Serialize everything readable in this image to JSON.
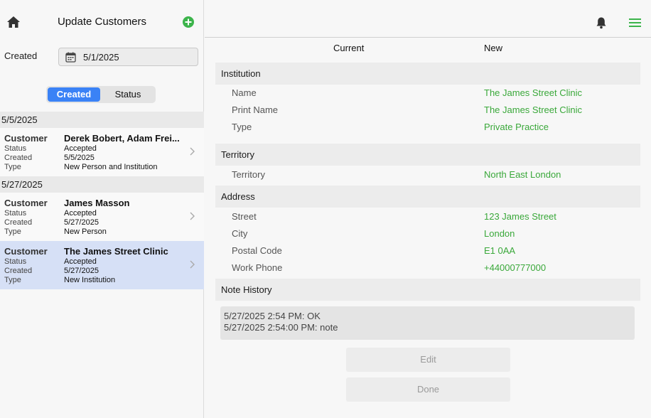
{
  "header": {
    "title": "Update Customers"
  },
  "filter": {
    "created_label": "Created",
    "created_date": "5/1/2025"
  },
  "segmented": {
    "options": [
      "Created",
      "Status"
    ],
    "selected": "Created"
  },
  "groups": [
    {
      "date": "5/5/2025",
      "rows": [
        {
          "customer": "Derek Bobert, Adam Frei...",
          "status": "Accepted",
          "created": "5/5/2025",
          "type": "New Person and Institution"
        }
      ]
    },
    {
      "date": "5/27/2025",
      "rows": [
        {
          "customer": "James Masson",
          "status": "Accepted",
          "created": "5/27/2025",
          "type": "New Person"
        },
        {
          "customer": "The James Street Clinic",
          "status": "Accepted",
          "created": "5/27/2025",
          "type": "New Institution",
          "selected": true
        }
      ]
    }
  ],
  "row_labels": {
    "customer": "Customer",
    "status": "Status",
    "created": "Created",
    "type": "Type"
  },
  "detail": {
    "columns": {
      "current": "Current",
      "new": "New"
    },
    "sections": {
      "institution": {
        "title": "Institution",
        "fields": [
          {
            "label": "Name",
            "new": "The James Street Clinic"
          },
          {
            "label": "Print Name",
            "new": "The James Street Clinic"
          },
          {
            "label": "Type",
            "new": "Private Practice"
          }
        ]
      },
      "territory": {
        "title": "Territory",
        "fields": [
          {
            "label": "Territory",
            "new": "North East London"
          }
        ]
      },
      "address": {
        "title": "Address",
        "fields": [
          {
            "label": "Street",
            "new": "123 James Street"
          },
          {
            "label": "City",
            "new": "London"
          },
          {
            "label": "Postal Code",
            "new": "E1 0AA"
          },
          {
            "label": "Work Phone",
            "new": "+44000777000"
          }
        ]
      }
    },
    "note_history": {
      "title": "Note History",
      "lines": [
        "5/27/2025 2:54 PM: OK",
        "5/27/2025 2:54:00 PM: note"
      ]
    },
    "buttons": {
      "edit": "Edit",
      "done": "Done"
    }
  },
  "colors": {
    "accent": "#3a82f6",
    "new_value": "#3aa83a",
    "add_icon": "#3cb44b",
    "menu_icon": "#3cb44b",
    "selected_row": "#d6e0f6"
  },
  "icons": {
    "home": "home-icon",
    "add": "plus-circle-icon",
    "calendar": "calendar-icon",
    "bell": "bell-icon",
    "menu": "hamburger-menu-icon",
    "chevron": "chevron-right-icon"
  }
}
